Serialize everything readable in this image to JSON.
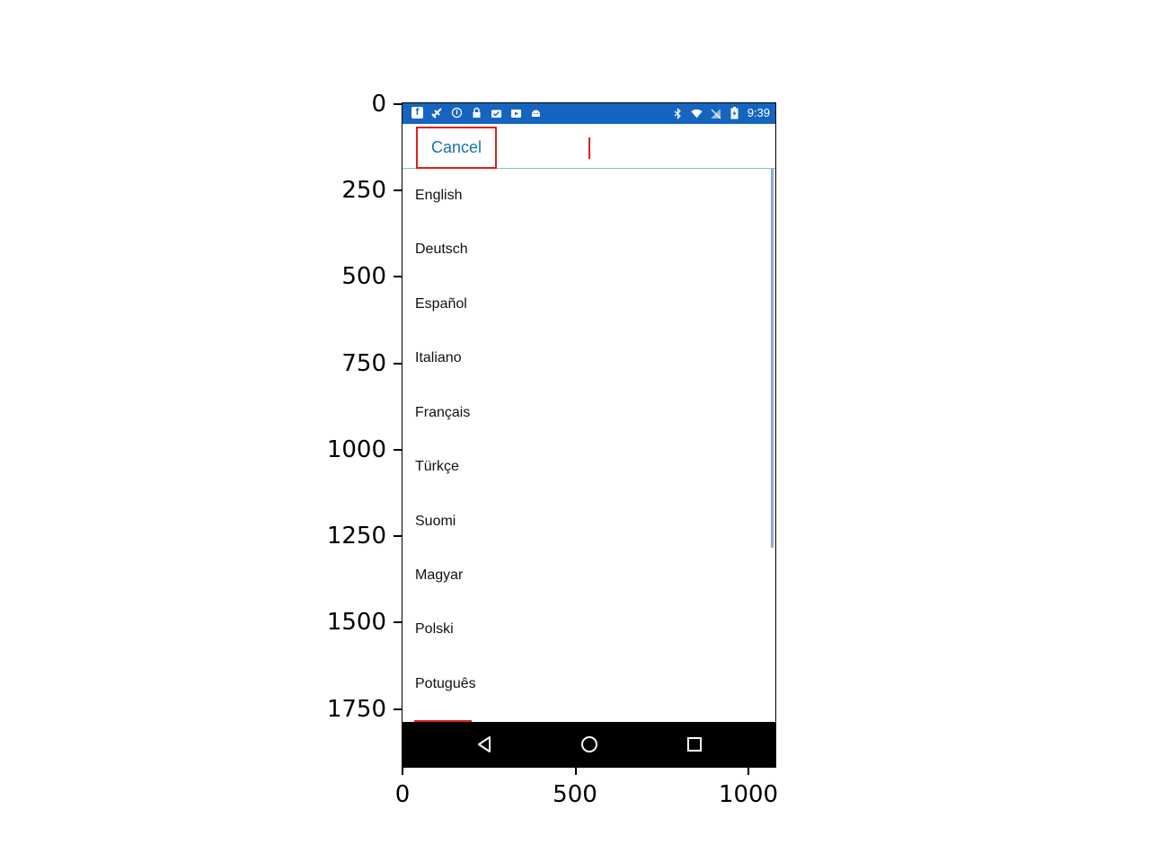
{
  "axes": {
    "y_ticks": [
      "0",
      "250",
      "500",
      "750",
      "1000",
      "1250",
      "1500",
      "1750"
    ],
    "x_ticks": [
      "0",
      "500",
      "1000"
    ]
  },
  "status_bar": {
    "time": "9:39",
    "background": "#1565c0",
    "left_icons": [
      "facebook-icon",
      "satellite-icon",
      "info-icon",
      "lock-icon",
      "briefcase-check-icon",
      "youtube-icon",
      "android-icon"
    ],
    "right_icons": [
      "bluetooth-icon",
      "wifi-icon",
      "no-signal-icon",
      "battery-charging-icon"
    ]
  },
  "toolbar": {
    "cancel_label": "Cancel",
    "accent": "#1a73a8",
    "highlight": "#e02020"
  },
  "languages": [
    "English",
    "Deutsch",
    "Español",
    "Italiano",
    "Français",
    "Türkçe",
    "Suomi",
    "Magyar",
    "Polski",
    "Potuguês"
  ],
  "nav_bar": {
    "icons": [
      "back-icon",
      "home-icon",
      "recents-icon"
    ]
  }
}
